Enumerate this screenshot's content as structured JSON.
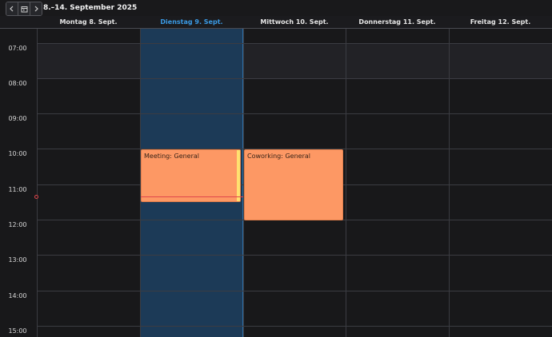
{
  "toolbar": {
    "range_label": "8.–14. September 2025",
    "prev_icon": "chevron-left-icon",
    "calendar_icon": "calendar-icon",
    "next_icon": "chevron-right-icon"
  },
  "days": [
    {
      "label": "Montag 8. Sept.",
      "today": false
    },
    {
      "label": "Dienstag 9. Sept.",
      "today": true
    },
    {
      "label": "Mittwoch 10. Sept.",
      "today": false
    },
    {
      "label": "Donnerstag 11. Sept.",
      "today": false
    },
    {
      "label": "Freitag 12. Sept.",
      "today": false
    }
  ],
  "hours": [
    "07:00",
    "08:00",
    "09:00",
    "10:00",
    "11:00",
    "12:00",
    "13:00",
    "14:00",
    "15:00"
  ],
  "events": [
    {
      "title": "Meeting: General",
      "day": "Dienstag 9. Sept."
    },
    {
      "title": "Coworking: General",
      "day": "Mittwoch 10. Sept."
    }
  ],
  "colors": {
    "today_accent": "#3a9be6",
    "today_column": "#1c3a57",
    "event_fill": "#fd9864",
    "now_indicator": "#e0474c"
  }
}
